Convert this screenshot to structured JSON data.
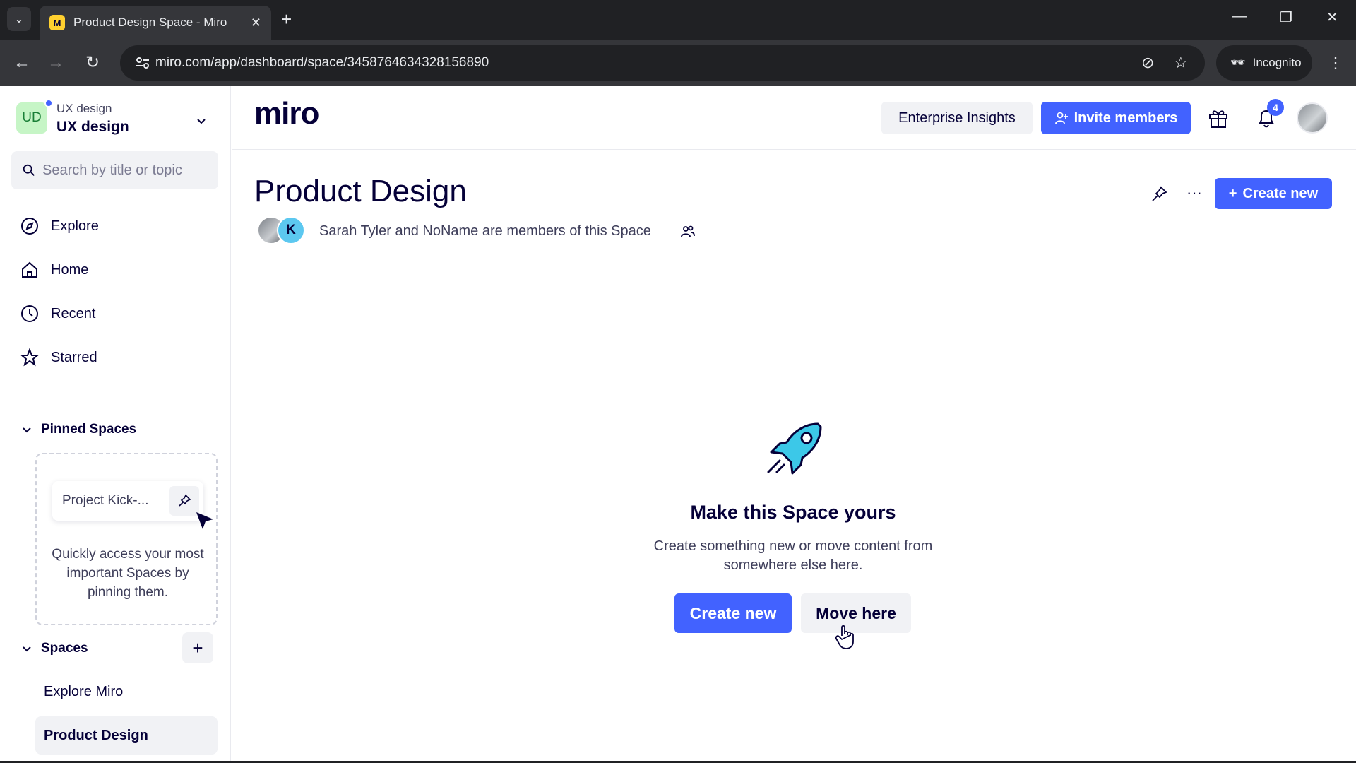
{
  "browser": {
    "tab_title": "Product Design Space - Miro",
    "favicon_letter": "M",
    "url": "miro.com/app/dashboard/space/3458764634328156890",
    "incognito_label": "Incognito"
  },
  "sidebar": {
    "workspace_initials": "UD",
    "workspace_small": "UX design",
    "workspace_name": "UX design",
    "search_placeholder": "Search by title or topic",
    "nav": [
      {
        "label": "Explore",
        "icon": "compass-icon"
      },
      {
        "label": "Home",
        "icon": "home-icon"
      },
      {
        "label": "Recent",
        "icon": "clock-icon"
      },
      {
        "label": "Starred",
        "icon": "star-icon"
      }
    ],
    "pinned_heading": "Pinned Spaces",
    "pinned_card_label": "Project Kick-...",
    "pinned_help": "Quickly access your most important Spaces by pinning them.",
    "spaces_heading": "Spaces",
    "spaces": [
      {
        "label": "Explore Miro",
        "active": false
      },
      {
        "label": "Product Design",
        "active": true
      }
    ]
  },
  "header": {
    "logo": "miro",
    "enterprise_label": "Enterprise Insights",
    "invite_label": "Invite members",
    "notification_count": "4"
  },
  "space": {
    "title": "Product Design",
    "member_initial": "K",
    "members_text": "Sarah Tyler and NoName are members of this Space",
    "create_new_label": "Create new"
  },
  "empty_state": {
    "title": "Make this Space yours",
    "description": "Create something new or move content from somewhere else here.",
    "create_label": "Create new",
    "move_label": "Move here"
  },
  "colors": {
    "accent": "#4262ff",
    "text": "#050038",
    "rocket": "#3cc8e8"
  }
}
